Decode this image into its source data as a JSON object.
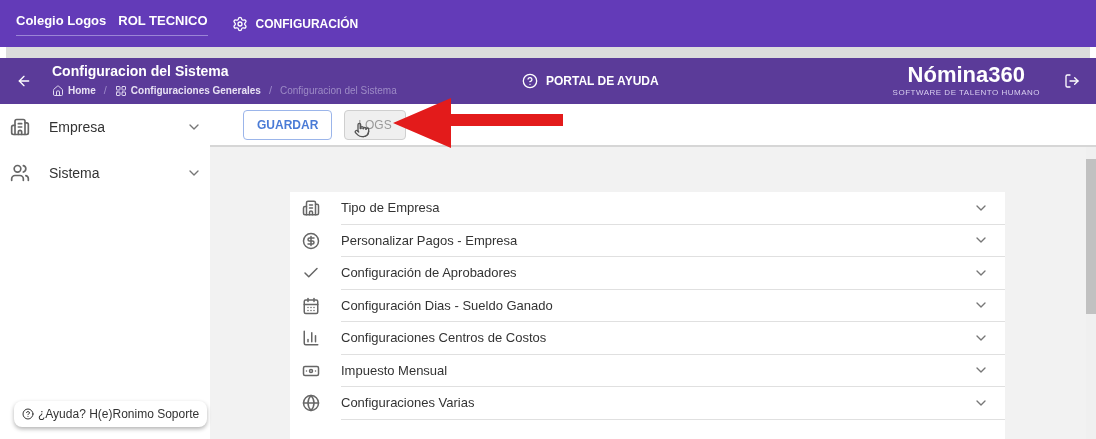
{
  "top_bar": {
    "company": "Colegio Logos",
    "role": "ROL TECNICO",
    "menu": "CONFIGURACIÓN"
  },
  "header": {
    "title": "Configuracion del Sistema",
    "breadcrumbs": [
      {
        "label": "Home",
        "kind": "home"
      },
      {
        "label": "Configuraciones Generales",
        "kind": "grid"
      },
      {
        "label": "Configuracion del Sistema",
        "kind": "current"
      }
    ],
    "breadcrumb_separator": "/",
    "help": "PORTAL DE AYUDA",
    "logo": "Nómina360",
    "logo_tagline": "SOFTWARE DE TALENTO HUMANO"
  },
  "sidebar": {
    "items": [
      {
        "label": "Empresa",
        "kind": "building"
      },
      {
        "label": "Sistema",
        "kind": "people"
      }
    ],
    "help_chip": "¿Ayuda? H(e)Ronimo Soporte"
  },
  "toolbar": {
    "buttons": [
      {
        "label": "GUARDAR",
        "kind": "primary"
      },
      {
        "label": "LOGS",
        "kind": "secondary"
      }
    ]
  },
  "sections": [
    {
      "label": "Tipo de Empresa",
      "kind": "building"
    },
    {
      "label": "Personalizar Pagos - Empresa",
      "kind": "dollar"
    },
    {
      "label": "Configuración de Aprobadores",
      "kind": "check"
    },
    {
      "label": "Configuración Dias - Sueldo Ganado",
      "kind": "calendar"
    },
    {
      "label": "Configuraciones Centros de Costos",
      "kind": "chart"
    },
    {
      "label": "Impuesto Mensual",
      "kind": "bill"
    },
    {
      "label": "Configuraciones Varias",
      "kind": "globe"
    }
  ]
}
